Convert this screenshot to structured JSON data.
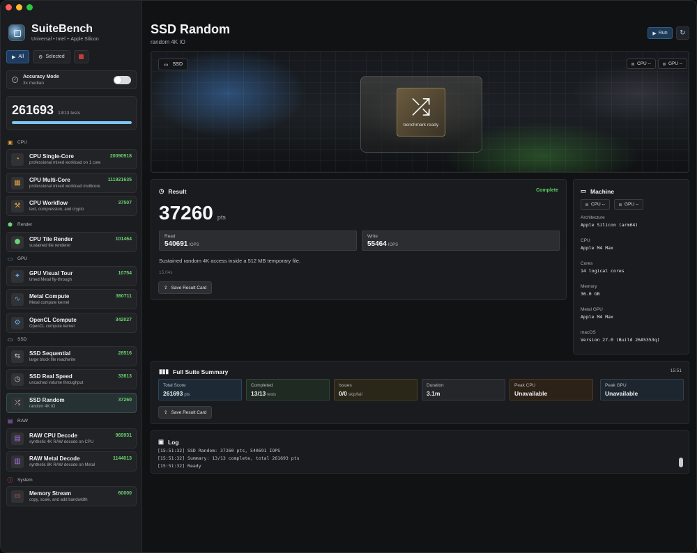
{
  "app": {
    "name": "SuiteBench",
    "subtitle": "Universal • Intel + Apple Silicon"
  },
  "filters": {
    "all": "All",
    "selected": "Selected"
  },
  "accuracy": {
    "title": "Accuracy Mode",
    "subtitle": "3x median",
    "enabled": false
  },
  "total": {
    "score": "261693",
    "tests": "13/13 tests",
    "progress": 1.0
  },
  "categories": [
    {
      "label": "CPU",
      "icon": "cpu-icon",
      "color": "#e6a33b"
    },
    {
      "label": "Render",
      "icon": "cube-icon",
      "color": "#6ed17a"
    },
    {
      "label": "GPU",
      "icon": "display-icon",
      "color": "#62a8e8"
    },
    {
      "label": "SSD",
      "icon": "drive-icon",
      "color": "#c7c9cc"
    },
    {
      "label": "RAW",
      "icon": "film-icon",
      "color": "#b072e0"
    },
    {
      "label": "System",
      "icon": "info-icon",
      "color": "#e36a4f"
    }
  ],
  "benchmarks": [
    {
      "name": "CPU Single-Core",
      "desc": "professional mixed workload on 1 core",
      "score": "20090918",
      "icon": "clock-icon",
      "glyph": "◔",
      "color": "#e6a33b"
    },
    {
      "name": "CPU Multi-Core",
      "desc": "professional mixed workload multicore",
      "score": "111921635",
      "icon": "chip-icon",
      "glyph": "▦",
      "color": "#e6a33b"
    },
    {
      "name": "CPU Workflow",
      "desc": "text, compression, and crypto",
      "score": "37507",
      "icon": "hammer-icon",
      "glyph": "⚒",
      "color": "#e6a33b"
    },
    {
      "name": "CPU Tile Render",
      "desc": "sustained tile renderer",
      "score": "101464",
      "icon": "cube-icon",
      "glyph": "⬢",
      "color": "#6ed17a"
    },
    {
      "name": "GPU Visual Tour",
      "desc": "timed Metal fly-through",
      "score": "10754",
      "icon": "sparkle-icon",
      "glyph": "✦",
      "color": "#62a8e8"
    },
    {
      "name": "Metal Compute",
      "desc": "Metal compute kernel",
      "score": "360711",
      "icon": "wave-icon",
      "glyph": "∿",
      "color": "#62a8e8"
    },
    {
      "name": "OpenCL Compute",
      "desc": "OpenCL compute kernel",
      "score": "342027",
      "icon": "gear-icon",
      "glyph": "⚙",
      "color": "#62a8e8"
    },
    {
      "name": "SSD Sequential",
      "desc": "large block file read/write",
      "score": "28516",
      "icon": "arrows-icon",
      "glyph": "⇆",
      "color": "#c7c9cc"
    },
    {
      "name": "SSD Real Speed",
      "desc": "uncached volume throughput",
      "score": "33613",
      "icon": "gauge-icon",
      "glyph": "◷",
      "color": "#c7c9cc"
    },
    {
      "name": "SSD Random",
      "desc": "random 4K IO",
      "score": "37260",
      "icon": "shuffle-icon",
      "glyph": "⤮",
      "color": "#c7c9cc"
    },
    {
      "name": "RAW CPU Decode",
      "desc": "synthetic 4K RAW decode on CPU",
      "score": "969931",
      "icon": "film-icon",
      "glyph": "▤",
      "color": "#b072e0"
    },
    {
      "name": "RAW Metal Decode",
      "desc": "synthetic 8K RAW decode on Metal",
      "score": "1144013",
      "icon": "film-stack-icon",
      "glyph": "▥",
      "color": "#b072e0"
    },
    {
      "name": "Memory Stream",
      "desc": "copy, scale, and add bandwidth",
      "score": "60000",
      "icon": "memory-icon",
      "glyph": "▭",
      "color": "#e36a4f"
    }
  ],
  "header": {
    "title": "SSD Random",
    "subtitle": "random 4K IO",
    "run_label": "Run"
  },
  "hero": {
    "badge": "SSD",
    "cpu": "CPU --",
    "gpu": "GPU --",
    "status": "benchmark ready"
  },
  "result": {
    "title": "Result",
    "status": "Complete",
    "score": "37260",
    "unit": "pts",
    "read_label": "Read",
    "read_value": "540691",
    "read_unit": "IOPS",
    "write_label": "Write",
    "write_value": "55464",
    "write_unit": "IOPS",
    "description": "Sustained random 4K access inside a 512 MB temporary file.",
    "duration": "15.04s",
    "save_label": "Save Result Card"
  },
  "machine": {
    "title": "Machine",
    "cpu_chip": "CPU --",
    "gpu_chip": "GPU --",
    "rows": [
      {
        "key": "Architecture",
        "value": "Apple Silicon (arm64)"
      },
      {
        "key": "CPU",
        "value": "Apple M4 Max"
      },
      {
        "key": "Cores",
        "value": "14 logical cores"
      },
      {
        "key": "Memory",
        "value": "36.0 GB"
      },
      {
        "key": "Metal GPU",
        "value": "Apple M4 Max"
      },
      {
        "key": "macOS",
        "value": "Version 27.0 (Build 26A5353q)"
      }
    ]
  },
  "suite": {
    "title": "Full Suite Summary",
    "time": "15:51",
    "stats": [
      {
        "label": "Total Score",
        "value": "261693",
        "unit": "pts",
        "bg": "#1d2a36",
        "border": "#2f4458"
      },
      {
        "label": "Completed",
        "value": "13/13",
        "unit": "tests",
        "bg": "#1e2a22",
        "border": "#2f4a36"
      },
      {
        "label": "Issues",
        "value": "0/0",
        "unit": "skip/fail",
        "bg": "#2a2618",
        "border": "#4a4126"
      },
      {
        "label": "Duration",
        "value": "3.1m",
        "unit": "",
        "bg": "#25262a",
        "border": "#3a3c41"
      },
      {
        "label": "Peak CPU",
        "value": "Unavailable",
        "unit": "",
        "bg": "#2c2218",
        "border": "#4d3a26"
      },
      {
        "label": "Peak GPU",
        "value": "Unavailable",
        "unit": "",
        "bg": "#1d262e",
        "border": "#304250"
      }
    ],
    "save_label": "Save Result Card"
  },
  "log": {
    "title": "Log",
    "lines": [
      "[15:51:32] SSD Random: 37260 pts, 540691 IOPS",
      "[15:51:32] Summary: 13/13 complete, total 261693 pts",
      "[15:51:32] Ready"
    ]
  }
}
